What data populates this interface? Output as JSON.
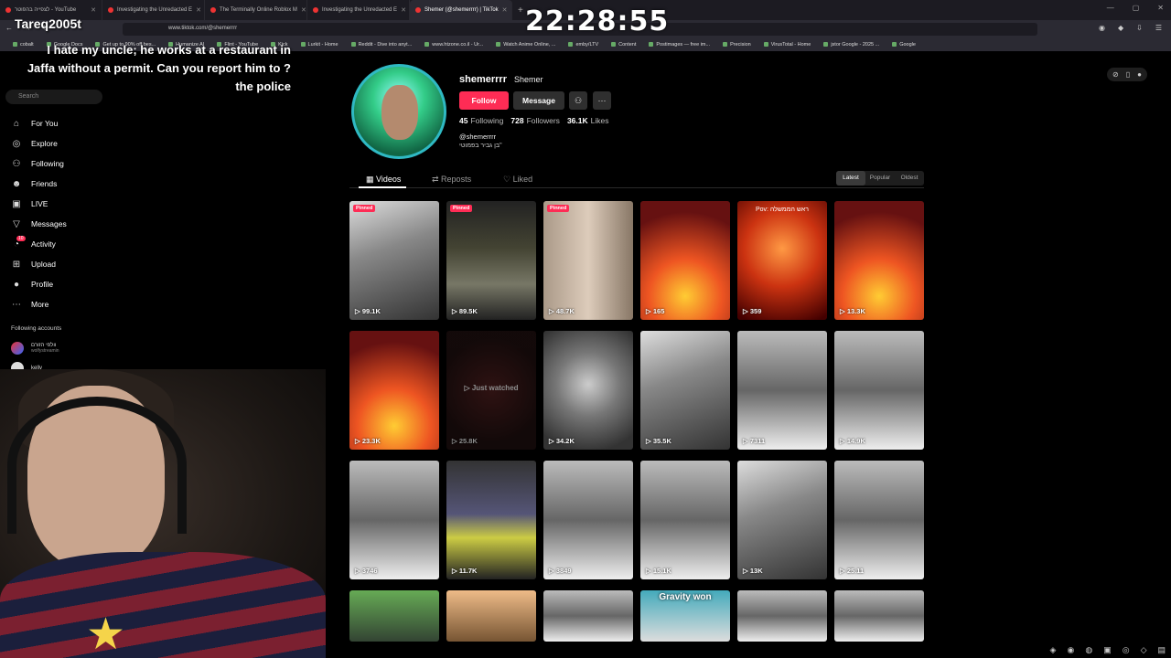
{
  "browser": {
    "tabs": [
      {
        "title": "לצפייה בהפוטר - YouTube",
        "active": false
      },
      {
        "title": "Investigating the Unredacted E",
        "active": false
      },
      {
        "title": "The Terminally Online Roblox M",
        "active": false
      },
      {
        "title": "Investigating the Unredacted E",
        "active": false
      },
      {
        "title": "Shemer (@shemerrrr) | TikTok",
        "active": true
      }
    ],
    "new_tab": "+",
    "url": "www.tiktok.com/@shemerrrr",
    "bookmarks": [
      "cobalt",
      "Google Docs",
      "Get up to 90% off bes...",
      "Humanize AI",
      "Flint - YouTube",
      "Kick",
      "Lurkit - Home",
      "Reddit - Dive into anyt...",
      "www.htzone.co.il - Ur...",
      "Watch Anime Online, ...",
      "emby/LTV",
      "Content",
      "Postimages — free im...",
      "Precision",
      "VirusTotal - Home",
      "jstor Google - 2025 ...",
      "Google"
    ]
  },
  "overlay": {
    "clock": "22:28:55",
    "streamer_name": "Tareq2005t",
    "caption": "I hate my uncle; he works at a restaurant in Jaffa without a permit. Can you report him to ?the police"
  },
  "sidebar": {
    "logo": "TikTok",
    "search_placeholder": "Search",
    "items": [
      {
        "label": "For You",
        "icon": "home-icon"
      },
      {
        "label": "Explore",
        "icon": "compass-icon"
      },
      {
        "label": "Following",
        "icon": "following-icon"
      },
      {
        "label": "Friends",
        "icon": "friends-icon"
      },
      {
        "label": "LIVE",
        "icon": "live-icon"
      },
      {
        "label": "Messages",
        "icon": "messages-icon"
      },
      {
        "label": "Activity",
        "icon": "bell-icon",
        "badge": "10"
      },
      {
        "label": "Upload",
        "icon": "upload-icon"
      },
      {
        "label": "Profile",
        "icon": "profile-icon"
      },
      {
        "label": "More",
        "icon": "more-icon"
      }
    ],
    "following_title": "Following accounts",
    "following": [
      {
        "name": "וולפי הזורם",
        "handle": "wolfystreamin"
      },
      {
        "name": "kelly",
        "handle": ""
      }
    ]
  },
  "profile": {
    "username": "shemerrrr",
    "nickname": "Shemer",
    "follow_label": "Follow",
    "message_label": "Message",
    "following_count": "45",
    "following_label": "Following",
    "followers_count": "728",
    "followers_label": "Followers",
    "likes_count": "36.1K",
    "likes_label": "Likes",
    "handle": "@shemerrrr",
    "bio": "בן גביר בפמוטי\""
  },
  "tabs": {
    "videos": "Videos",
    "reposts": "Reposts",
    "liked": "Liked"
  },
  "sort": {
    "latest": "Latest",
    "popular": "Popular",
    "oldest": "Oldest"
  },
  "videos": [
    {
      "views": "99.1K",
      "pinned": "Pinned",
      "theme": "t-bw1"
    },
    {
      "views": "89.5K",
      "pinned": "Pinned",
      "theme": "t-night"
    },
    {
      "views": "48.7K",
      "pinned": "Pinned",
      "theme": "t-door"
    },
    {
      "views": "165",
      "theme": "t-fire"
    },
    {
      "views": "359",
      "theme": "t-fire2",
      "top": "Pov: ראש הממשלה"
    },
    {
      "views": "13.3K",
      "theme": "t-fire"
    },
    {
      "views": "23.3K",
      "theme": "t-fire"
    },
    {
      "views": "25.8K",
      "theme": "t-dark",
      "center": "Just watched",
      "watched": true
    },
    {
      "views": "34.2K",
      "theme": "t-face"
    },
    {
      "views": "35.5K",
      "theme": "t-bw1"
    },
    {
      "views": "7311",
      "theme": "t-bw2"
    },
    {
      "views": "14.9K",
      "theme": "t-bw2"
    },
    {
      "views": "3746",
      "theme": "t-bw2"
    },
    {
      "views": "11.7K",
      "theme": "t-station"
    },
    {
      "views": "3849",
      "theme": "t-bw2"
    },
    {
      "views": "15.1K",
      "theme": "t-bw2"
    },
    {
      "views": "13K",
      "theme": "t-bw1"
    },
    {
      "views": "25.11",
      "theme": "t-bw2"
    },
    {
      "views": "",
      "theme": "t-green",
      "short": true
    },
    {
      "views": "",
      "theme": "t-warm",
      "short": true
    },
    {
      "views": "",
      "theme": "t-bw2",
      "short": true
    },
    {
      "views": "",
      "theme": "t-blue",
      "short": true,
      "big": "Gravity won"
    },
    {
      "views": "",
      "theme": "t-bw2",
      "short": true
    },
    {
      "views": "",
      "theme": "t-bw2",
      "short": true
    }
  ]
}
